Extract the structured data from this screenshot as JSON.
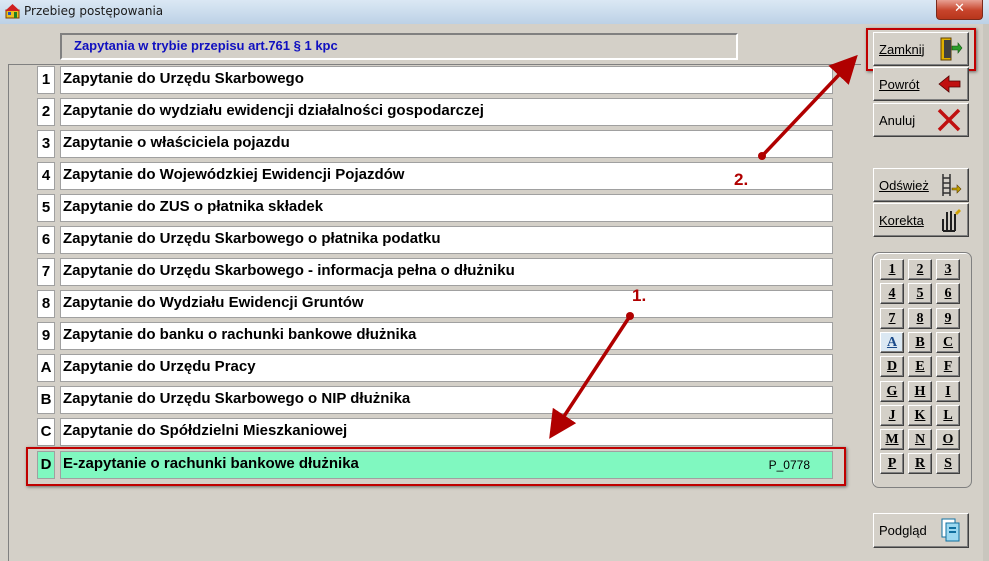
{
  "window": {
    "title": "Przebieg postępowania",
    "close_glyph": "✕"
  },
  "header": {
    "title": "Zapytania w trybie przepisu art.761 § 1 kpc"
  },
  "rows": [
    {
      "key": "1",
      "label": "Zapytanie do Urzędu Skarbowego",
      "code": ""
    },
    {
      "key": "2",
      "label": "Zapytanie do wydziału ewidencji działalności gospodarczej",
      "code": ""
    },
    {
      "key": "3",
      "label": "Zapytanie o właściciela pojazdu",
      "code": ""
    },
    {
      "key": "4",
      "label": "Zapytanie do Wojewódzkiej Ewidencji Pojazdów",
      "code": ""
    },
    {
      "key": "5",
      "label": "Zapytanie do ZUS o płatnika składek",
      "code": ""
    },
    {
      "key": "6",
      "label": "Zapytanie do Urzędu Skarbowego o płatnika podatku",
      "code": ""
    },
    {
      "key": "7",
      "label": "Zapytanie do Urzędu Skarbowego - informacja pełna o dłużniku",
      "code": ""
    },
    {
      "key": "8",
      "label": "Zapytanie do Wydziału Ewidencji Gruntów",
      "code": ""
    },
    {
      "key": "9",
      "label": "Zapytanie do banku o rachunki bankowe dłużnika",
      "code": ""
    },
    {
      "key": "A",
      "label": "Zapytanie do Urzędu Pracy",
      "code": ""
    },
    {
      "key": "B",
      "label": "Zapytanie do Urzędu Skarbowego o NIP dłużnika",
      "code": ""
    },
    {
      "key": "C",
      "label": "Zapytanie do Spółdzielni Mieszkaniowej",
      "code": ""
    },
    {
      "key": "D",
      "label": "E-zapytanie o rachunki bankowe dłużnika",
      "code": "P_0778",
      "selected": true
    }
  ],
  "buttons": {
    "close": {
      "label": "Zamknij",
      "icon": "exit-door-icon"
    },
    "back": {
      "label": "Powrót",
      "icon": "arrow-left-icon"
    },
    "cancel": {
      "label": "Anuluj",
      "icon": "red-x-icon"
    },
    "refresh": {
      "label": "Odśwież",
      "icon": "ladder-arrow-icon"
    },
    "correction": {
      "label": "Korekta",
      "icon": "hand-pointer-icon"
    },
    "preview": {
      "label": "Podgląd",
      "icon": "document-preview-icon"
    }
  },
  "keypad": {
    "keys": [
      "1",
      "2",
      "3",
      "4",
      "5",
      "6",
      "7",
      "8",
      "9",
      "A",
      "B",
      "C",
      "D",
      "E",
      "F",
      "G",
      "H",
      "I",
      "J",
      "K",
      "L",
      "M",
      "N",
      "O",
      "P",
      "R",
      "S"
    ],
    "active_key": "A"
  },
  "annotations": {
    "step1": "1.",
    "step2": "2."
  },
  "colors": {
    "selected_row": "#80f8c0",
    "header_text": "#1010c0",
    "annotation": "#b00000"
  }
}
